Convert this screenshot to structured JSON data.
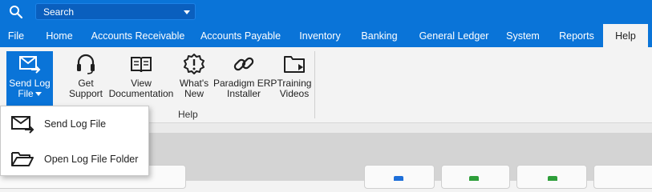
{
  "search": {
    "placeholder": "Search"
  },
  "tabs": [
    {
      "label": "File",
      "active": false
    },
    {
      "label": "Home",
      "active": false
    },
    {
      "label": "Accounts Receivable",
      "active": false
    },
    {
      "label": "Accounts Payable",
      "active": false
    },
    {
      "label": "Inventory",
      "active": false
    },
    {
      "label": "Banking",
      "active": false
    },
    {
      "label": "General Ledger",
      "active": false
    },
    {
      "label": "System",
      "active": false
    },
    {
      "label": "Reports",
      "active": false
    },
    {
      "label": "Help",
      "active": true
    }
  ],
  "ribbon": {
    "group_label": "Help",
    "buttons": [
      {
        "line1": "Send Log",
        "line2": "File",
        "icon": "envelope-arrow-icon",
        "selected": true
      },
      {
        "line1": "Get",
        "line2": "Support",
        "icon": "headset-icon",
        "selected": false
      },
      {
        "line1": "View",
        "line2": "Documentation",
        "icon": "book-icon",
        "selected": false
      },
      {
        "line1": "What's",
        "line2": "New",
        "icon": "alert-badge-icon",
        "selected": false
      },
      {
        "line1": "Paradigm ERP",
        "line2": "Installer",
        "icon": "link-icon",
        "selected": false
      },
      {
        "line1": "Training",
        "line2": "Videos",
        "icon": "video-folder-icon",
        "selected": false
      }
    ]
  },
  "dropdown": {
    "items": [
      {
        "label": "Send Log File",
        "icon": "envelope-arrow-icon"
      },
      {
        "label": "Open Log File Folder",
        "icon": "folder-open-icon"
      }
    ]
  },
  "colors": {
    "accent": "#0a74d8",
    "card_dots": [
      "#1e6fd9",
      "#2e9e3a",
      "#2e9e3a"
    ]
  }
}
